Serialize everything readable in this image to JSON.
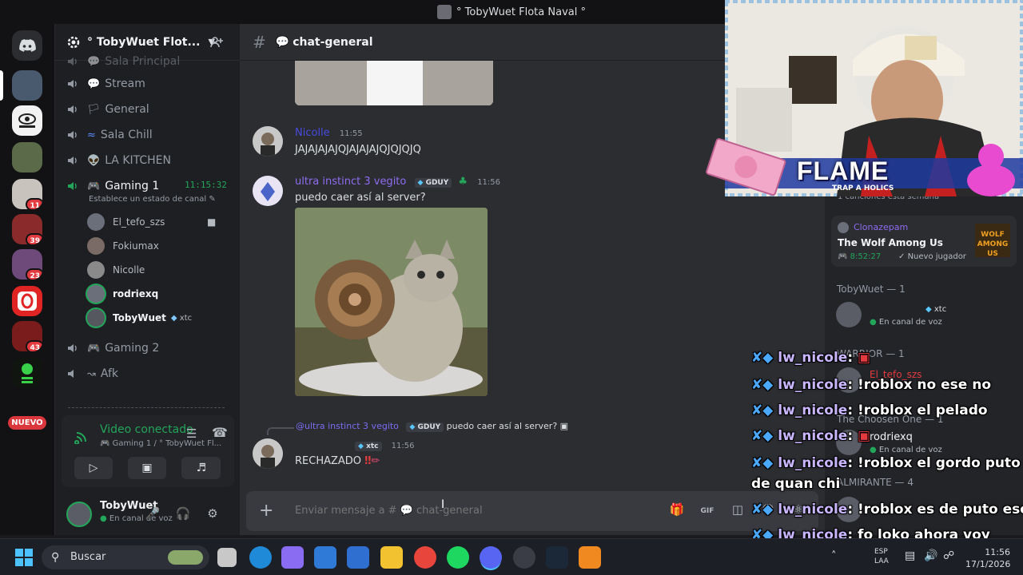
{
  "window": {
    "title": "° TobyWuet Flota Naval °"
  },
  "rail": {
    "badges": [
      "11",
      "39",
      "23",
      "43"
    ],
    "nuevo": "NUEVO"
  },
  "server": {
    "name": "° TobyWuet Flot..."
  },
  "channels": [
    {
      "label": "Sala Principal",
      "icon": "chat"
    },
    {
      "label": "Stream",
      "icon": "chat"
    },
    {
      "label": "General",
      "icon": "flag"
    },
    {
      "label": "Sala Chill",
      "icon": "wave"
    },
    {
      "label": "LA KITCHEN",
      "icon": "alien"
    },
    {
      "label": "Gaming 1",
      "icon": "gamepad"
    },
    {
      "label": "Gaming 2",
      "icon": "gamepad"
    },
    {
      "label": "Afk",
      "icon": "arrow"
    }
  ],
  "gaming1": {
    "timer": "11:15:32",
    "status": "Establece un estado de canal"
  },
  "voice_users": [
    {
      "name": "El_tefo_szs",
      "tag": ""
    },
    {
      "name": "Fokiumax",
      "tag": ""
    },
    {
      "name": "Nicolle",
      "tag": ""
    },
    {
      "name": "rodriexq",
      "tag": ""
    },
    {
      "name": "TobyWuet",
      "tag": "xtc"
    }
  ],
  "voice_panel": {
    "title": "Video conectado",
    "subtitle": "Gaming 1 / ° TobyWuet Fl..."
  },
  "user_panel": {
    "name": "TobyWuet",
    "status": "En canal de voz"
  },
  "chat": {
    "channel": "chat-general",
    "messages": [
      {
        "author": "Nicolle",
        "time": "11:55",
        "text": "JAJAJAJAJQJAJAJAJQJQJQJQ",
        "color": "#3f3fd9"
      },
      {
        "author": "ultra instinct 3 vegito",
        "tag": "GDUY",
        "time": "11:56",
        "text": "puedo caer así al server?",
        "color": "#8f6cf2"
      }
    ],
    "reply": {
      "ref_author": "@ultra instinct 3 vegito",
      "ref_tag": "GDUY",
      "ref_text": "puedo caer así al server?",
      "tag": "xtc",
      "time": "11:56",
      "text": "RECHAZADO"
    },
    "input_placeholder": "Enviar mensaje a # 💬 chat-general"
  },
  "members": {
    "card_header": "1 canciones esta semana",
    "activity_user": "Clonazepam",
    "activity_game": "The Wolf Among Us",
    "activity_time": "8:52:27",
    "activity_note": "Nuevo jugador",
    "groups": [
      {
        "title": "TobyWuet — 1",
        "user_tag": "xtc",
        "user_status": "En canal de voz"
      },
      {
        "title": "WARRIOR — 1",
        "user": "El_tefo_szs"
      },
      {
        "title": "The Choosen One — 1",
        "user": "rodriexq",
        "user_status": "En canal de voz"
      },
      {
        "title": "ALMIRANTE — 4"
      }
    ]
  },
  "stream_overlay": {
    "banner": "FLAME",
    "banner_sub": "TRAP A HOLICS",
    "chat_lines": [
      {
        "user": "lw_nicole",
        "text": ""
      },
      {
        "user": "lw_nicole",
        "text": "!roblox no ese no"
      },
      {
        "user": "lw_nicole",
        "text": "!roblox el pelado"
      },
      {
        "user": "lw_nicole",
        "text": ""
      },
      {
        "user": "lw_nicole",
        "text": "!roblox el gordo puto"
      },
      {
        "user": "",
        "text": "de quan chi"
      },
      {
        "user": "lw_nicole",
        "text": "!roblox es de puto ese"
      },
      {
        "user": "lw_nicole",
        "text": "fo loko ahora voy"
      },
      {
        "user": "lw_nicole",
        "text": ""
      }
    ]
  },
  "taskbar": {
    "search": "Buscar",
    "lang1": "ESP",
    "lang2": "LAA",
    "time": "11:56",
    "date": "17/1/2026"
  }
}
